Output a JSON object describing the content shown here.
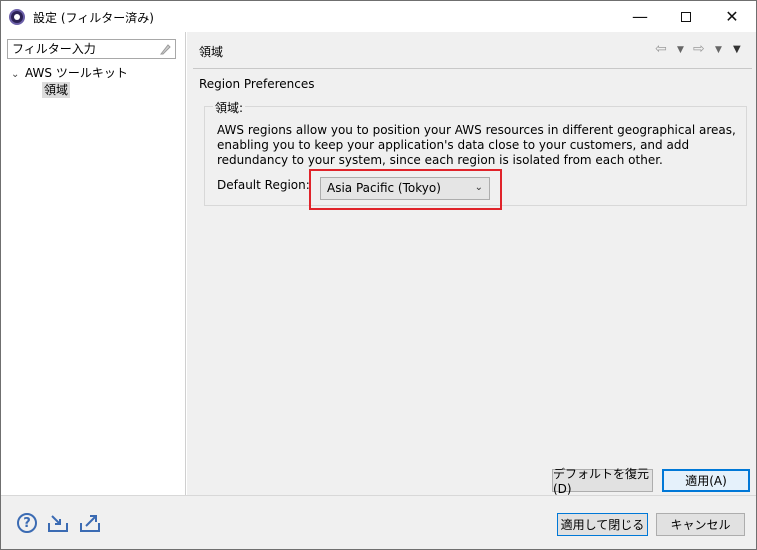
{
  "window": {
    "title": "設定 (フィルター済み)",
    "min_label": "—",
    "close_label": "✕"
  },
  "sidebar": {
    "filter_placeholder": "フィルター入力",
    "tree": [
      {
        "label": "AWS ツールキット",
        "expanded": true
      },
      {
        "label": "領域",
        "selected": true
      }
    ]
  },
  "page": {
    "title": "領域",
    "section_title": "Region Preferences",
    "group_label": "領域:",
    "description": "AWS regions allow you to position your AWS resources in different geographical areas, enabling you to keep your application's data close to your customers, and add redundancy to your system, since each region is isolated from each other.",
    "region_label": "Default Region:",
    "region_value": "Asia Pacific (Tokyo)",
    "restore_defaults_label": "デフォルトを復元(D)",
    "apply_label": "適用(A)"
  },
  "footer": {
    "apply_close_label": "適用して閉じる",
    "cancel_label": "キャンセル"
  },
  "colors": {
    "highlight": "#e0232a",
    "accent": "#0078d7"
  }
}
